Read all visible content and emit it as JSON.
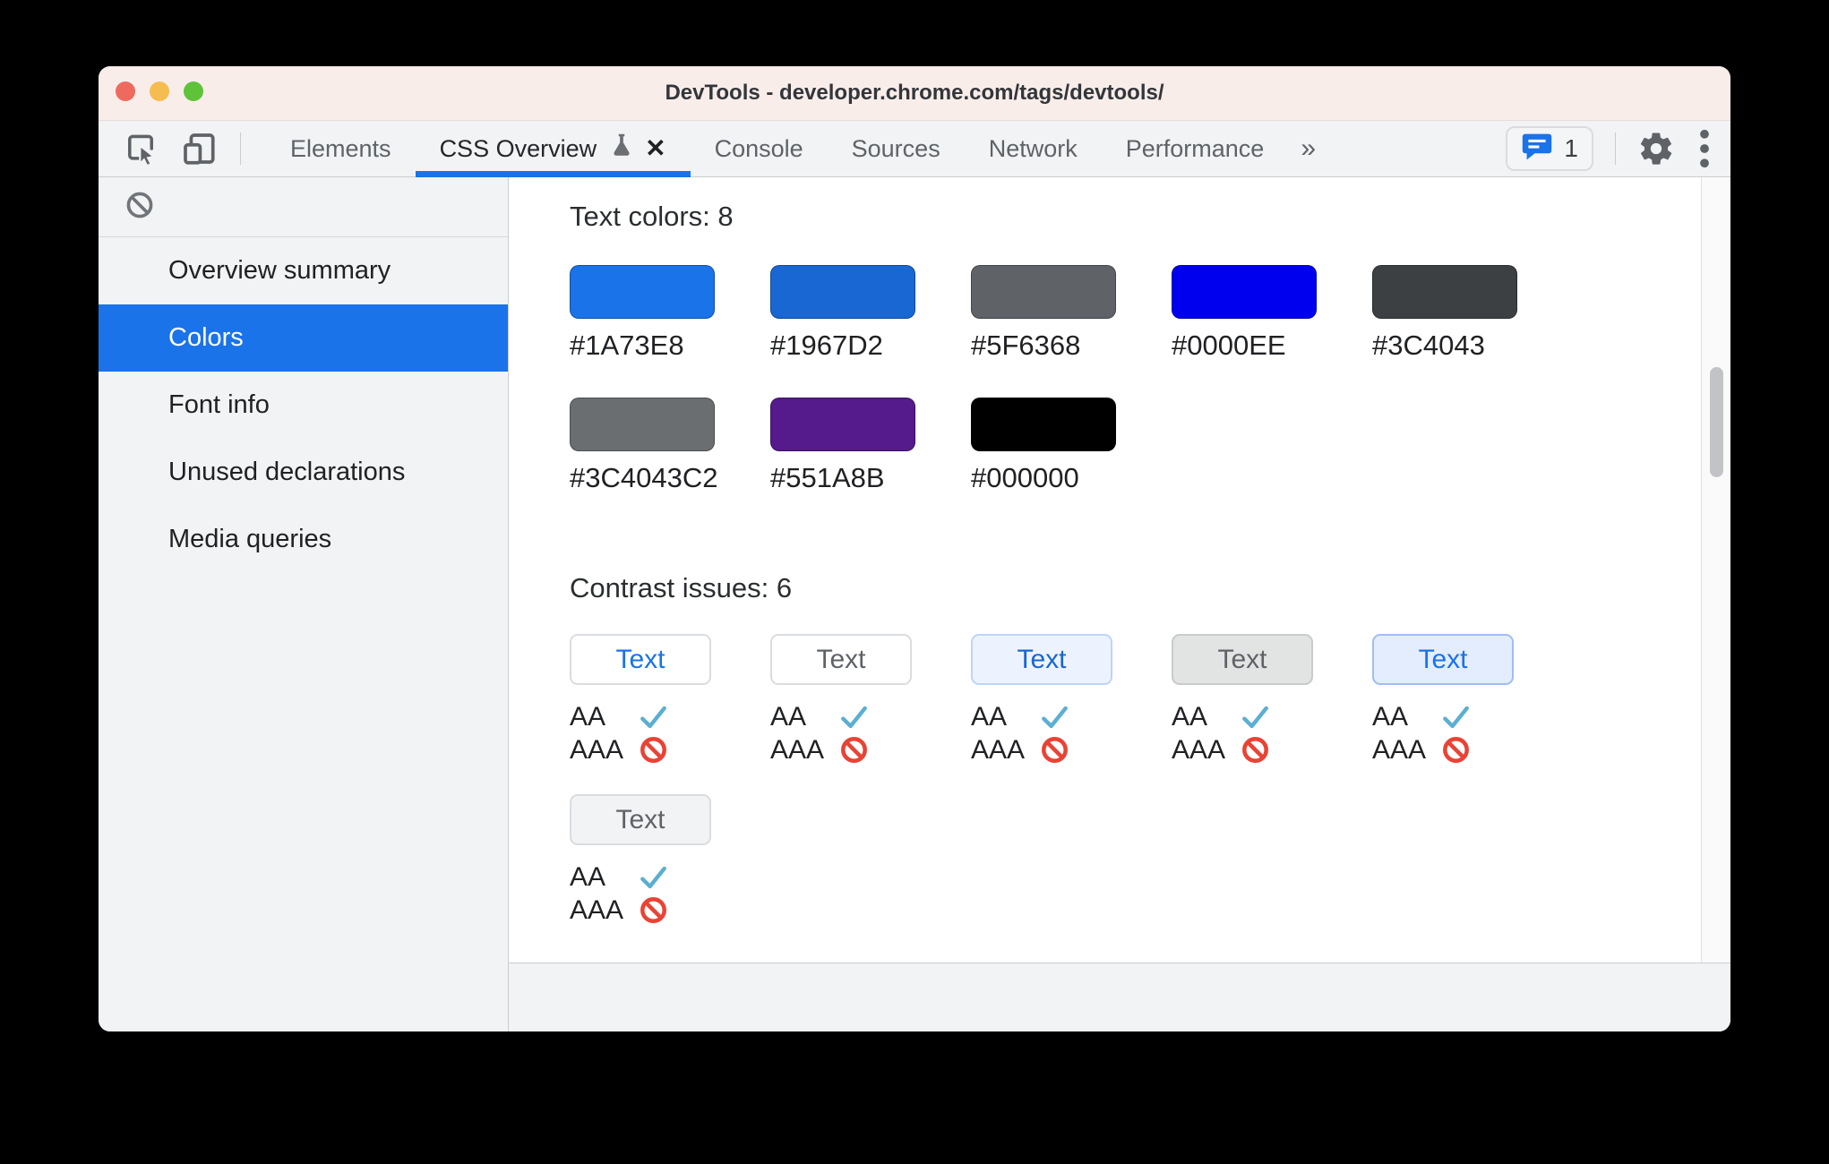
{
  "window": {
    "title": "DevTools - developer.chrome.com/tags/devtools/"
  },
  "theme": {
    "accent_blue": "#1A73E8",
    "titlebar_bg": "#F9EDEA",
    "toolbar_bg": "#F1F3F4",
    "pass_check_color": "#5BAFD0",
    "fail_icon_color": "#E94335"
  },
  "toolbar": {
    "tabs": [
      {
        "label": "Elements"
      },
      {
        "label": "CSS Overview"
      },
      {
        "label": "Console"
      },
      {
        "label": "Sources"
      },
      {
        "label": "Network"
      },
      {
        "label": "Performance"
      }
    ],
    "active_tab": "CSS Overview",
    "close_tab_label": "✕",
    "more_tabs_label": "»",
    "notification_count": "1"
  },
  "sidebar": {
    "items": [
      {
        "label": "Overview summary"
      },
      {
        "label": "Colors"
      },
      {
        "label": "Font info"
      },
      {
        "label": "Unused declarations"
      },
      {
        "label": "Media queries"
      }
    ],
    "selected_item": "Colors"
  },
  "main": {
    "text_colors_heading": "Text colors: 8",
    "swatches": [
      {
        "hex": "#1A73E8",
        "style": "background:#1A73E8"
      },
      {
        "hex": "#1967D2",
        "style": "background:#1967D2"
      },
      {
        "hex": "#5F6368",
        "style": "background:#5F6368"
      },
      {
        "hex": "#0000EE",
        "style": "background:#0000EE"
      },
      {
        "hex": "#3C4043",
        "style": "background:#3C4043"
      },
      {
        "hex": "#3C4043C2",
        "style": "background:rgba(60,64,67,0.76)"
      },
      {
        "hex": "#551A8B",
        "style": "background:#551A8B"
      },
      {
        "hex": "#000000",
        "style": "background:#000000"
      }
    ],
    "contrast_heading": "Contrast issues: 6",
    "sample_label": "Text",
    "aa_label": "AA",
    "aaa_label": "AAA",
    "samples": [
      {
        "aa": "pass",
        "aaa": "fail",
        "style": "background:#FFFFFF;border-color:#DADCE0;color:#1A73E8"
      },
      {
        "aa": "pass",
        "aaa": "fail",
        "style": "background:#FFFFFF;border-color:#DADCE0;color:#5F6368"
      },
      {
        "aa": "pass",
        "aaa": "fail",
        "style": "background:#EDF3FE;border-color:#BDD4FA;color:#1967D2"
      },
      {
        "aa": "pass",
        "aaa": "fail",
        "style": "background:#E2E3E3;border-color:#C9CACB;color:#5F6368"
      },
      {
        "aa": "pass",
        "aaa": "fail",
        "style": "background:#E4EDFD;border-color:#9FBDF2;color:#1A73E8"
      },
      {
        "aa": "pass",
        "aaa": "fail",
        "style": "background:#F1F3F4;border-color:#DADCE0;color:#5F6368"
      }
    ]
  }
}
